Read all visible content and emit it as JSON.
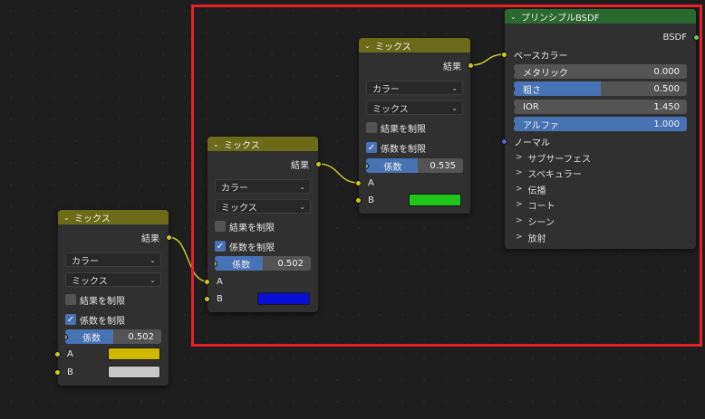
{
  "nodes": {
    "mix1": {
      "title": "ミックス",
      "output_label": "結果",
      "dtype": "カラー",
      "blend": "ミックス",
      "clamp_label": "結果を制限",
      "factor_clamp_label": "係数を制限",
      "factor_label": "係数",
      "factor_value": "0.502",
      "factor_fraction": 0.502,
      "a_label": "A",
      "b_label": "B",
      "a_color": "#d1b800",
      "b_color": "#c8c8c8"
    },
    "mix2": {
      "title": "ミックス",
      "output_label": "結果",
      "dtype": "カラー",
      "blend": "ミックス",
      "clamp_label": "結果を制限",
      "factor_clamp_label": "係数を制限",
      "factor_label": "係数",
      "factor_value": "0.502",
      "factor_fraction": 0.502,
      "a_label": "A",
      "b_label": "B",
      "b_color": "#0a0fd6"
    },
    "mix3": {
      "title": "ミックス",
      "output_label": "結果",
      "dtype": "カラー",
      "blend": "ミックス",
      "clamp_label": "結果を制限",
      "factor_clamp_label": "係数を制限",
      "factor_label": "係数",
      "factor_value": "0.535",
      "factor_fraction": 0.535,
      "a_label": "A",
      "b_label": "B",
      "b_color": "#1ec81a"
    },
    "bsdf": {
      "title": "プリンシプルBSDF",
      "output_label": "BSDF",
      "base_color_label": "ベースカラー",
      "metallic_label": "メタリック",
      "metallic_value": "0.000",
      "metallic_fraction": 0.0,
      "roughness_label": "粗さ",
      "roughness_value": "0.500",
      "roughness_fraction": 0.5,
      "ior_label": "IOR",
      "ior_value": "1.450",
      "alpha_label": "アルファ",
      "alpha_value": "1.000",
      "alpha_fraction": 1.0,
      "normal_label": "ノーマル",
      "panels": [
        "サブサーフェス",
        "スペキュラー",
        "伝播",
        "コート",
        "シーン",
        "放射"
      ]
    }
  },
  "colors": {
    "mix_header": "#6b6b1a",
    "bsdf_header": "#2b6a2f",
    "highlight": "#e8202a",
    "wire": "#c7c729"
  }
}
